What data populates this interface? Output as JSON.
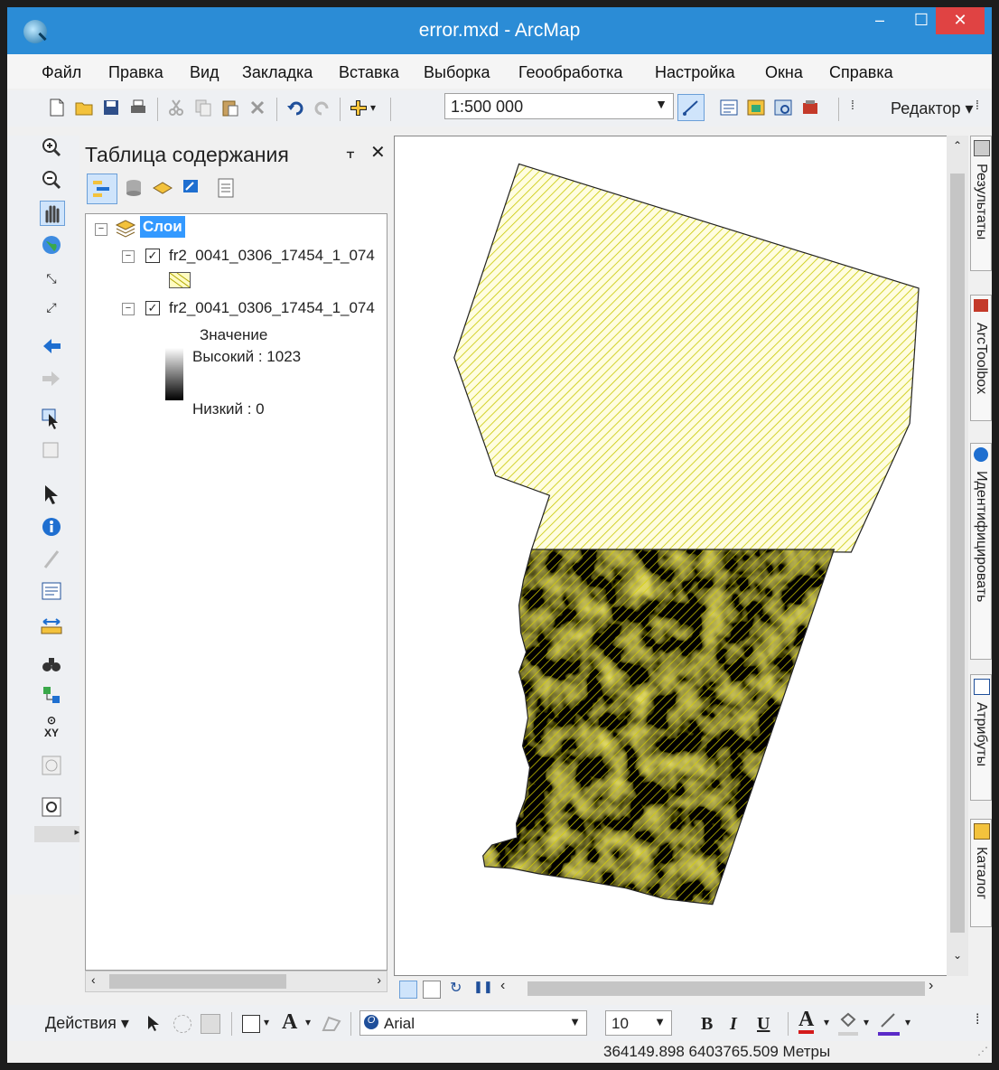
{
  "window": {
    "title": "error.mxd - ArcMap",
    "min": "‒",
    "max": "☐",
    "close": "✕"
  },
  "menu": [
    "Файл",
    "Правка",
    "Вид",
    "Закладка",
    "Вставка",
    "Выборка",
    "Геообработка",
    "Настройка",
    "Окна",
    "Справка"
  ],
  "toolbar": {
    "scale": "1:500 000",
    "editor": "Редактор ▾"
  },
  "toc": {
    "title": "Таблица содержания",
    "pin": "ᚁ",
    "close": "✕",
    "root_label": "Слои",
    "layers": [
      {
        "name": "fr2_0041_0306_17454_1_074",
        "checked": true
      },
      {
        "name": "fr2_0041_0306_17454_1_074",
        "checked": true
      }
    ],
    "legend_title": "Значение",
    "legend_high": "Высокий : 1023",
    "legend_low": "Низкий : 0"
  },
  "right_tabs": [
    "Результаты",
    "ArcToolbox",
    "Идентифицировать",
    "Атрибуты",
    "Каталог"
  ],
  "drawing": {
    "actions": "Действия ▾",
    "font": "Arial",
    "size": "10",
    "bold": "B",
    "italic": "I",
    "underline": "U",
    "font_color": "A"
  },
  "status": {
    "coordinates": "364149.898  6403765.509 Метры"
  },
  "colors": {
    "titlebar": "#2b8cd6",
    "close": "#e04343",
    "hatch": "#c8c800",
    "selection": "#3399ff"
  }
}
